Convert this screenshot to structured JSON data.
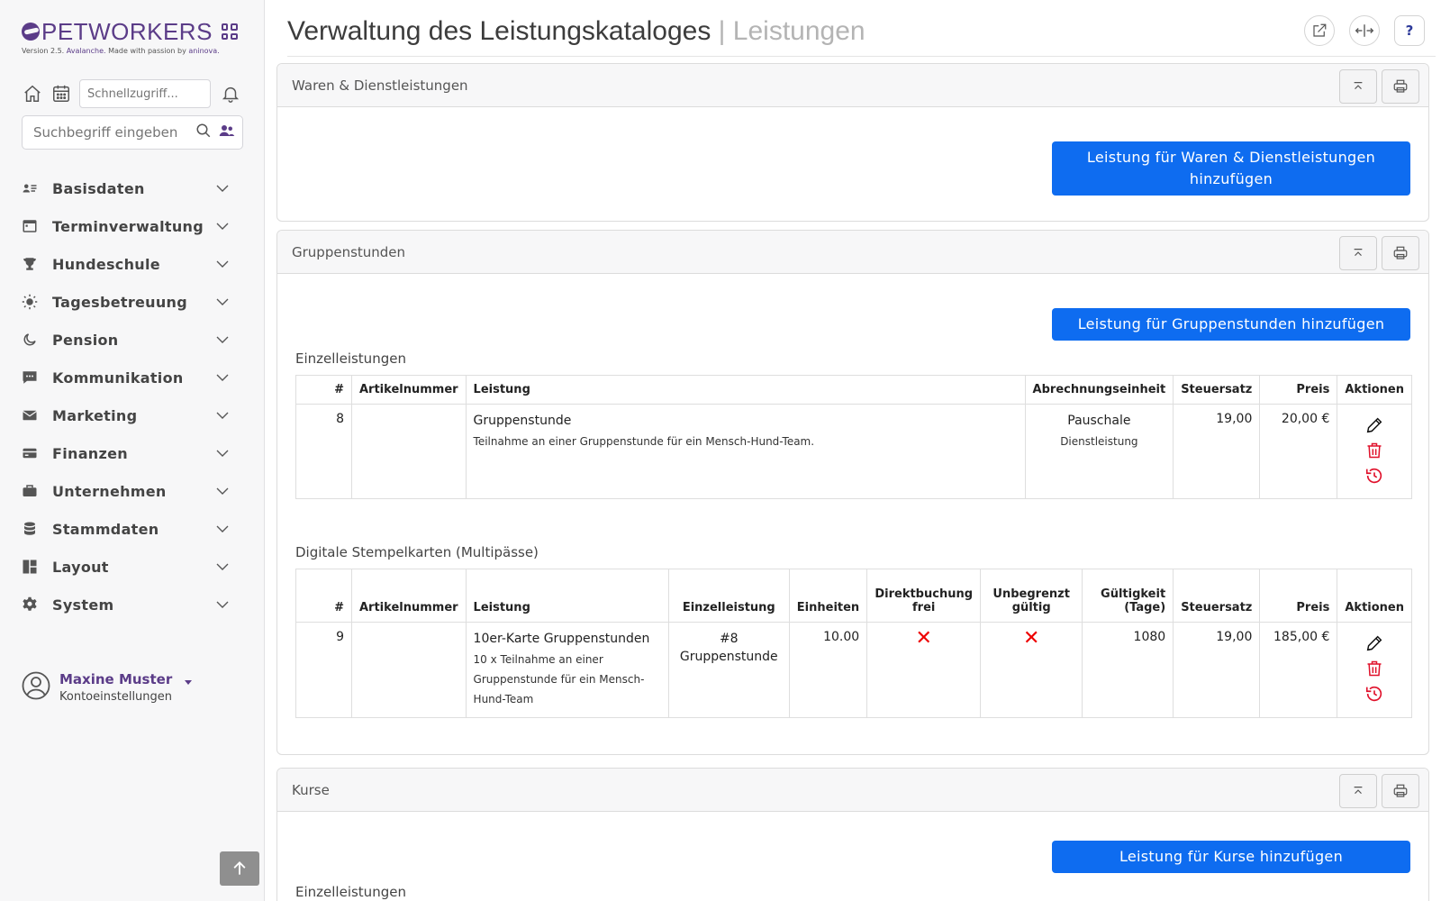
{
  "app": {
    "logo_text": "PETWORKERS",
    "version_prefix": "Version 2.5.",
    "version_name": "Avalanche.",
    "version_mid": "Made with passion by",
    "version_company": "aninova."
  },
  "sidebar": {
    "quick_placeholder": "Schnellzugriff...",
    "search_placeholder": "Suchbegriff eingeben",
    "items": [
      {
        "label": "Basisdaten",
        "icon": "user-card-icon"
      },
      {
        "label": "Terminverwaltung",
        "icon": "calendar-icon"
      },
      {
        "label": "Hundeschule",
        "icon": "trophy-icon"
      },
      {
        "label": "Tagesbetreuung",
        "icon": "sun-icon"
      },
      {
        "label": "Pension",
        "icon": "moon-icon"
      },
      {
        "label": "Kommunikation",
        "icon": "chat-icon"
      },
      {
        "label": "Marketing",
        "icon": "envelope-icon"
      },
      {
        "label": "Finanzen",
        "icon": "credit-card-icon"
      },
      {
        "label": "Unternehmen",
        "icon": "briefcase-icon"
      },
      {
        "label": "Stammdaten",
        "icon": "database-icon"
      },
      {
        "label": "Layout",
        "icon": "layout-icon"
      },
      {
        "label": "System",
        "icon": "gear-icon"
      }
    ],
    "user": {
      "name": "Maxine Muster",
      "account": "Kontoeinstellungen"
    }
  },
  "page": {
    "title": "Verwaltung des Leistungskataloges",
    "subtitle": "| Leistungen",
    "help_label": "?"
  },
  "sections": {
    "waren": {
      "title": "Waren & Dienstleistungen",
      "add_button": "Leistung für Waren & Dienstleistungen hinzufügen"
    },
    "gruppen": {
      "title": "Gruppenstunden",
      "add_button": "Leistung für Gruppenstunden hinzufügen",
      "single_label": "Einzelleistungen",
      "single_headers": {
        "num": "#",
        "article": "Artikelnummer",
        "service": "Leistung",
        "unit": "Abrechnungseinheit",
        "tax": "Steuersatz",
        "price": "Preis",
        "actions": "Aktionen"
      },
      "single_rows": [
        {
          "num": "8",
          "article": "",
          "service": "Gruppenstunde",
          "description": "Teilnahme an einer Gruppenstunde für ein Mensch-Hund-Team.",
          "unit": "Pauschale",
          "unit_type": "Dienstleistung",
          "tax": "19,00",
          "price": "20,00 €"
        }
      ],
      "multi_label": "Digitale Stempelkarten (Multipässe)",
      "multi_headers": {
        "num": "#",
        "article": "Artikelnummer",
        "service": "Leistung",
        "single": "Einzelleistung",
        "units": "Einheiten",
        "direct": "Direktbuchung frei",
        "unlimited": "Unbegrenzt gültig",
        "validity": "Gültigkeit (Tage)",
        "tax": "Steuersatz",
        "price": "Preis",
        "actions": "Aktionen"
      },
      "multi_rows": [
        {
          "num": "9",
          "article": "",
          "service": "10er-Karte Gruppenstunden",
          "description": "10 x Teilnahme an einer Gruppenstunde für ein Mensch-Hund-Team",
          "single": "#8 Gruppenstunde",
          "units": "10.00",
          "direct": false,
          "unlimited": false,
          "validity": "1080",
          "tax": "19,00",
          "price": "185,00 €"
        }
      ]
    },
    "kurse": {
      "title": "Kurse",
      "add_button": "Leistung für Kurse hinzufügen",
      "single_label": "Einzelleistungen"
    }
  },
  "colors": {
    "primary": "#0e6cf0",
    "brand": "#5b3c88",
    "danger": "#e0112b"
  }
}
